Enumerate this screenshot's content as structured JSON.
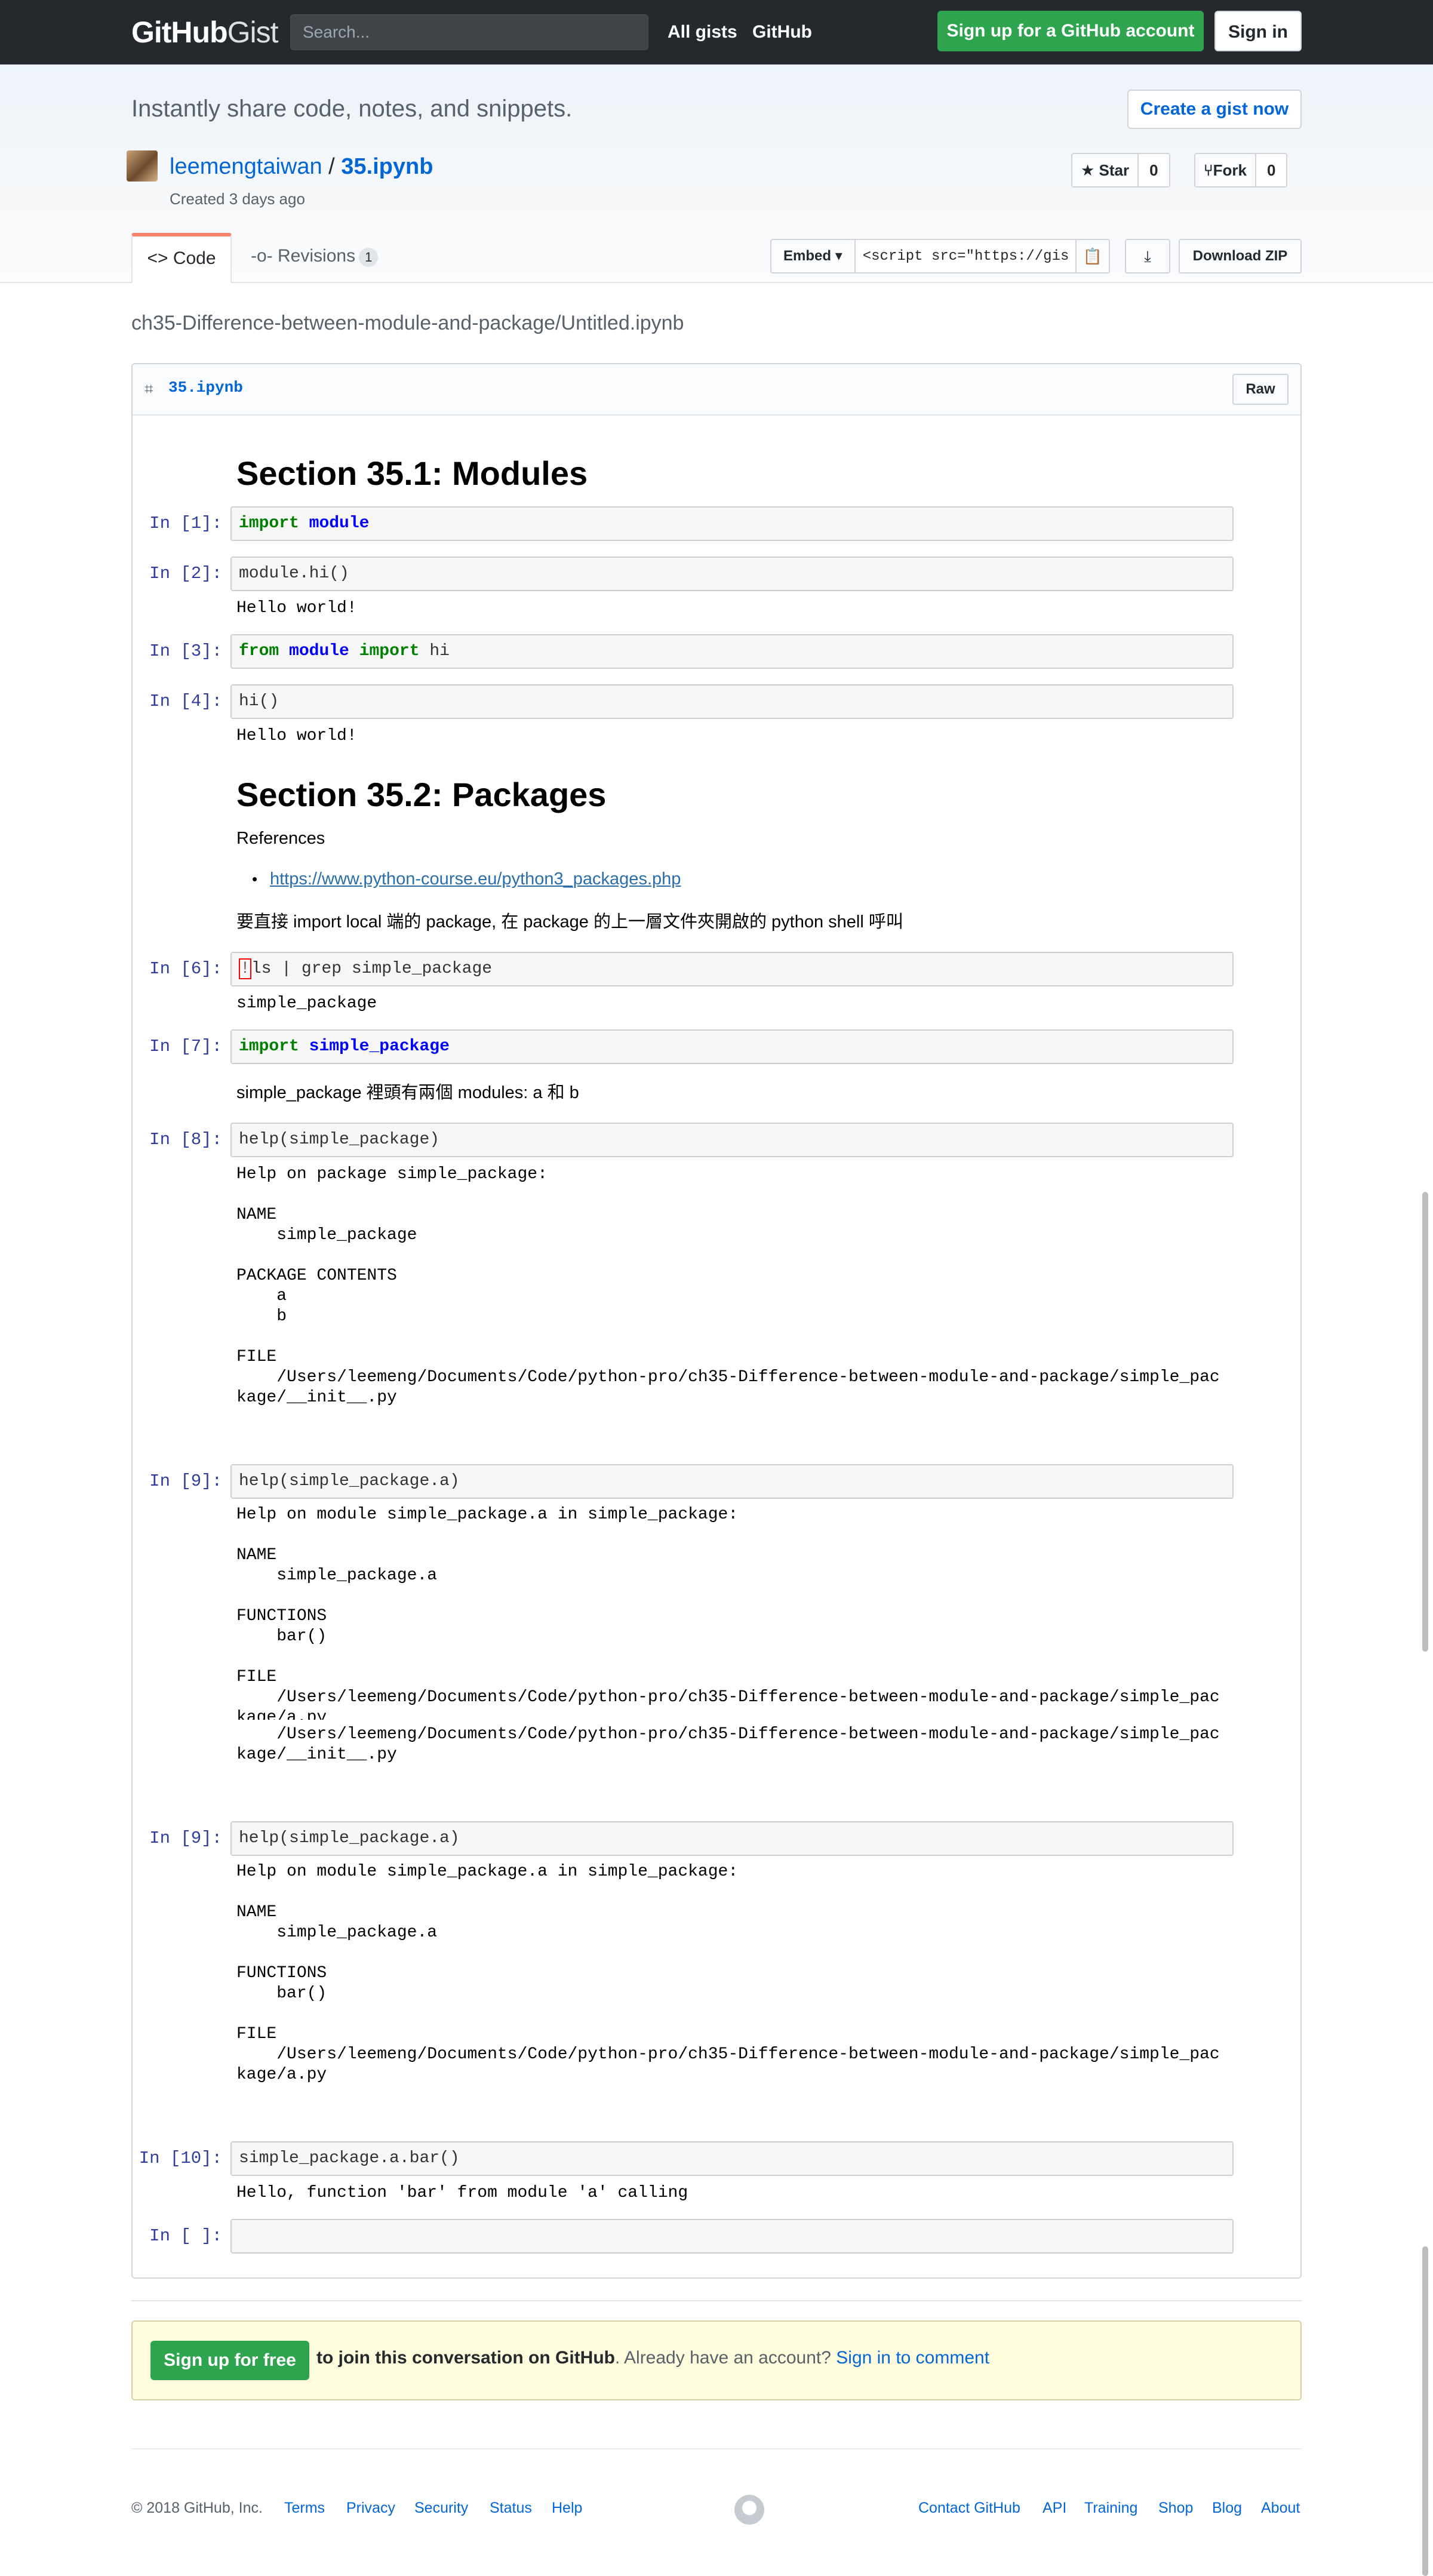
{
  "header": {
    "logo_bold": "GitHub",
    "logo_thin": "Gist",
    "search_placeholder": "Search...",
    "nav": [
      "All gists",
      "GitHub"
    ],
    "signup_button": "Sign up for a GitHub account",
    "signin_button": "Sign in"
  },
  "pagehead": {
    "tagline": "Instantly share code, notes, and snippets.",
    "create_button": "Create a gist now",
    "owner": "leemengtaiwan",
    "separator": "/",
    "gist_name": "35.ipynb",
    "created": "Created 3 days ago",
    "star": {
      "label": "Star",
      "count": "0"
    },
    "fork": {
      "label": "Fork",
      "count": "0"
    },
    "tabs": {
      "code": "Code",
      "revisions": "Revisions",
      "revisions_count": "1"
    },
    "embed_label": "Embed",
    "embed_value": "<script src=\"https://gist.github.com/",
    "download_zip": "Download ZIP"
  },
  "file": {
    "path": "ch35-Difference-between-module-and-package/Untitled.ipynb",
    "name": "35.ipynb",
    "raw_button": "Raw"
  },
  "notebook": {
    "section1": "Section 35.1: Modules",
    "section2": "Section 35.2: Packages",
    "references": "References",
    "ref_link": "https://www.python-course.eu/python3_packages.php",
    "zh_note": "要直接 import local 端的 package, 在 package 的上一層文件夾開啟的 python shell 呼叫",
    "pkg_note": "simple_package 裡頭有兩個 modules: a 和 b",
    "prompts": [
      "In [1]:",
      "In [2]:",
      "In [3]:",
      "In [4]:",
      "In [6]:",
      "In [7]:",
      "In [8]:",
      "In [9]:",
      "In [9]:",
      "In [10]:",
      "In [ ]:"
    ],
    "cells": {
      "c1_kw": "import",
      "c1_nm": "module",
      "c2": "module.hi()",
      "out_hello": "Hello world!",
      "c3_from": "from",
      "c3_mod": "module",
      "c3_import": "import",
      "c3_rest": "hi",
      "c4": "hi()",
      "c6_bang": "!",
      "c6_rest": "ls | grep simple_package",
      "out6": "simple_package",
      "c7_kw": "import",
      "c7_nm": "simple_package",
      "c8": "help(simple_package)",
      "out8": "Help on package simple_package:\n\nNAME\n    simple_package\n\nPACKAGE CONTENTS\n    a\n    b\n\nFILE\n    /Users/leemeng/Documents/Code/python-pro/ch35-Difference-between-module-and-package/simple_pac\nkage/__init__.py",
      "c9": "help(simple_package.a)",
      "out9a": "Help on module simple_package.a in simple_package:\n\nNAME\n    simple_package.a\n\nFUNCTIONS\n    bar()\n\nFILE\n    /Users/leemeng/Documents/Code/python-pro/ch35-Difference-between-module-and-package/simple_pac\nkage/a.py",
      "out9a_over": "    /Users/leemeng/Documents/Code/python-pro/ch35-Difference-between-module-and-package/simple_pac\nkage/__init__.py",
      "out9b": "Help on module simple_package.a in simple_package:\n\nNAME\n    simple_package.a\n\nFUNCTIONS\n    bar()\n\nFILE\n    /Users/leemeng/Documents/Code/python-pro/ch35-Difference-between-module-and-package/simple_pac\nkage/a.py",
      "c10": "simple_package.a.bar()",
      "out10": "Hello, function 'bar' from module 'a' calling",
      "c_empty": ""
    }
  },
  "signup_prompt": {
    "button": "Sign up for free",
    "strong": "to join this conversation on GitHub",
    "middle": ". Already have an account?",
    "link": "Sign in to comment"
  },
  "footer": {
    "copyright": "© 2018 GitHub, Inc.",
    "left_links": [
      "Terms",
      "Privacy",
      "Security",
      "Status",
      "Help"
    ],
    "right_links": [
      "Contact GitHub",
      "API",
      "Training",
      "Shop",
      "Blog",
      "About"
    ]
  }
}
